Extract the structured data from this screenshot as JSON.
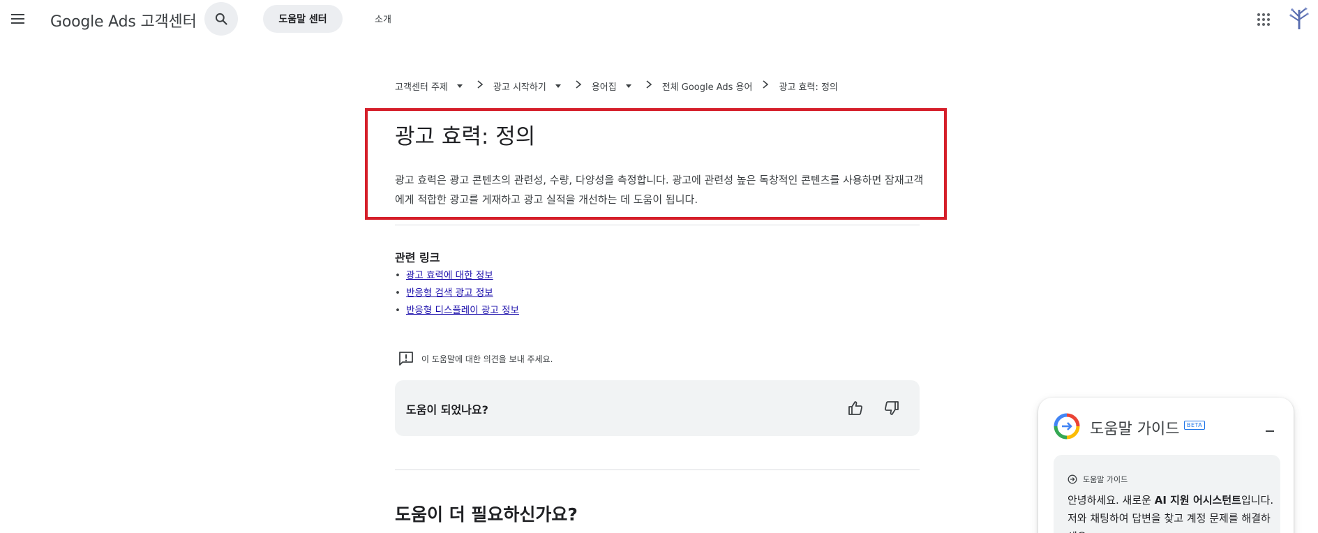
{
  "header": {
    "brand": "Google Ads 고객센터",
    "help_center_pill": "도움말 센터",
    "about_link": "소개"
  },
  "breadcrumb": [
    {
      "label": "고객센터 주제",
      "dropdown": true
    },
    {
      "label": "광고 시작하기",
      "dropdown": true
    },
    {
      "label": "용어집",
      "dropdown": true
    },
    {
      "label": "전체 Google Ads 용어",
      "dropdown": false
    },
    {
      "label": "광고 효력: 정의",
      "dropdown": false
    }
  ],
  "article": {
    "title": "광고 효력: 정의",
    "description": "광고 효력은 광고 콘텐츠의 관련성, 수량, 다양성을 측정합니다. 광고에 관련성 높은 독창적인 콘텐츠를 사용하면 잠재고객에게 적합한 광고를 게재하고 광고 실적을 개선하는 데 도움이 됩니다."
  },
  "related": {
    "title": "관련 링크",
    "links": [
      "광고 효력에 대한 정보",
      "반응형 검색 광고 정보",
      "반응형 디스플레이 광고 정보"
    ]
  },
  "feedback_link": "이 도움말에 대한 의견을 보내 주세요.",
  "helpful": {
    "question": "도움이 되었나요?"
  },
  "need_more_help": "도움이 더 필요하신가요?",
  "guide": {
    "title": "도움말 가이드",
    "beta": "BETA",
    "card_header": "도움말 가이드",
    "text_before": "안녕하세요. 새로운 ",
    "text_bold": "AI 지원 어시스턴트",
    "text_after": "입니다. 저와 채팅하여 답변을 찾고 계정 문제를 해결하세요."
  },
  "colors": {
    "highlight_border": "#d51f2a",
    "link": "#1a0dab",
    "pill_bg": "#eceef1",
    "card_bg": "#f1f3f4",
    "accent_blue": "#1a73e8"
  },
  "icons": [
    "menu-icon",
    "search-icon",
    "apps-grid-icon",
    "avatar-tree-icon",
    "chevron-right-icon",
    "dropdown-caret-icon",
    "feedback-icon",
    "thumbs-up-icon",
    "thumbs-down-icon",
    "help-guide-logo-icon",
    "minimize-icon",
    "guide-arrow-icon"
  ]
}
